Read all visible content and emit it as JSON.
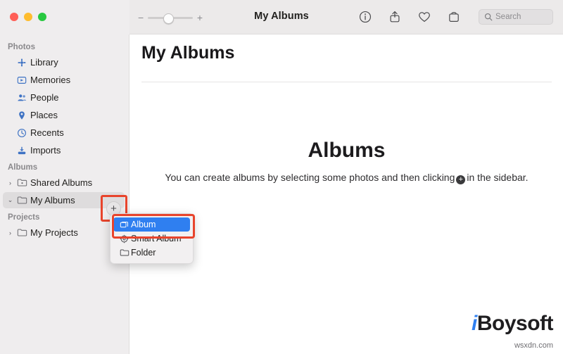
{
  "window": {
    "title": "My Albums",
    "traffic_lights": [
      "close",
      "minimize",
      "maximize"
    ]
  },
  "toolbar": {
    "zoom_minus": "−",
    "zoom_plus": "+",
    "icons": [
      "info-icon",
      "share-icon",
      "heart-icon",
      "rotate-icon"
    ],
    "search": {
      "placeholder": "Search",
      "value": "",
      "icon": "search-icon"
    }
  },
  "sidebar": {
    "sections": [
      {
        "header": "Photos",
        "items": [
          {
            "label": "Library",
            "icon": "photos-library-icon",
            "chevron": "",
            "selected": false
          },
          {
            "label": "Memories",
            "icon": "memories-icon",
            "chevron": "",
            "selected": false
          },
          {
            "label": "People",
            "icon": "people-icon",
            "chevron": "",
            "selected": false
          },
          {
            "label": "Places",
            "icon": "places-pin-icon",
            "chevron": "",
            "selected": false
          },
          {
            "label": "Recents",
            "icon": "recents-clock-icon",
            "chevron": "",
            "selected": false
          },
          {
            "label": "Imports",
            "icon": "imports-arrow-icon",
            "chevron": "",
            "selected": false
          }
        ]
      },
      {
        "header": "Albums",
        "items": [
          {
            "label": "Shared Albums",
            "icon": "shared-folder-icon",
            "chevron": "›",
            "selected": false
          },
          {
            "label": "My Albums",
            "icon": "folder-icon",
            "chevron": "⌄",
            "selected": true
          }
        ]
      },
      {
        "header": "Projects",
        "items": [
          {
            "label": "My Projects",
            "icon": "folder-icon",
            "chevron": "›",
            "selected": false
          }
        ]
      }
    ],
    "add_button": {
      "label": "+",
      "name": "add-album-button"
    }
  },
  "context_menu": {
    "items": [
      {
        "label": "Album",
        "icon": "album-icon",
        "active": true
      },
      {
        "label": "Smart Album",
        "icon": "smart-album-gear-icon",
        "active": false
      },
      {
        "label": "Folder",
        "icon": "folder-icon",
        "active": false
      }
    ]
  },
  "main": {
    "page_title": "My Albums",
    "empty_state": {
      "title": "Albums",
      "text_before": "You can create albums by selecting some photos and then clicking",
      "inline_icon": "plus-circle-icon",
      "text_after": "in the sidebar."
    }
  },
  "watermark": {
    "brand_i": "i",
    "brand_rest": "Boysoft",
    "sub": "wsxdn.com"
  },
  "colors": {
    "accent_blue": "#2f7ff0",
    "highlight_red": "#e8442c",
    "sidebar_bg": "#efedee",
    "titlebar_bg": "#eceaea",
    "sidebar_icon_blue": "#3f73c4"
  }
}
